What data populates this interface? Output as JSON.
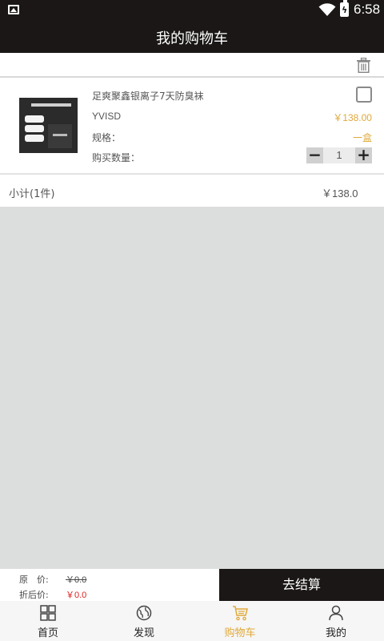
{
  "status_bar": {
    "time": "6:58",
    "battery_icon": "battery-charging-icon",
    "wifi_icon": "wifi-icon",
    "notification_icon": "image-icon"
  },
  "header": {
    "title": "我的购物车",
    "trash_icon": "trash-icon"
  },
  "cart_item": {
    "name": "足爽聚鑫银离子7天防臭袜",
    "sku": "YVISD",
    "price": "￥138.00",
    "spec_label": "规格：",
    "spec_value": "一盒",
    "quantity_label": "购买数量：",
    "quantity": "1",
    "minus": "−",
    "plus": "+"
  },
  "subtotal": {
    "label": "小计(1件)",
    "amount": "￥138.0"
  },
  "summary": {
    "original_label": "原　价:",
    "original_value": "￥0.0",
    "discount_label": "折后价:",
    "discount_value": "￥0.0"
  },
  "checkout_label": "去结算",
  "tabs": [
    {
      "label": "首页",
      "icon": "home-grid-icon"
    },
    {
      "label": "发现",
      "icon": "globe-icon"
    },
    {
      "label": "购物车",
      "icon": "cart-icon"
    },
    {
      "label": "我的",
      "icon": "user-icon"
    }
  ],
  "colors": {
    "accent": "#e0a93a",
    "bar": "#1a1716",
    "discount": "#e02020"
  }
}
